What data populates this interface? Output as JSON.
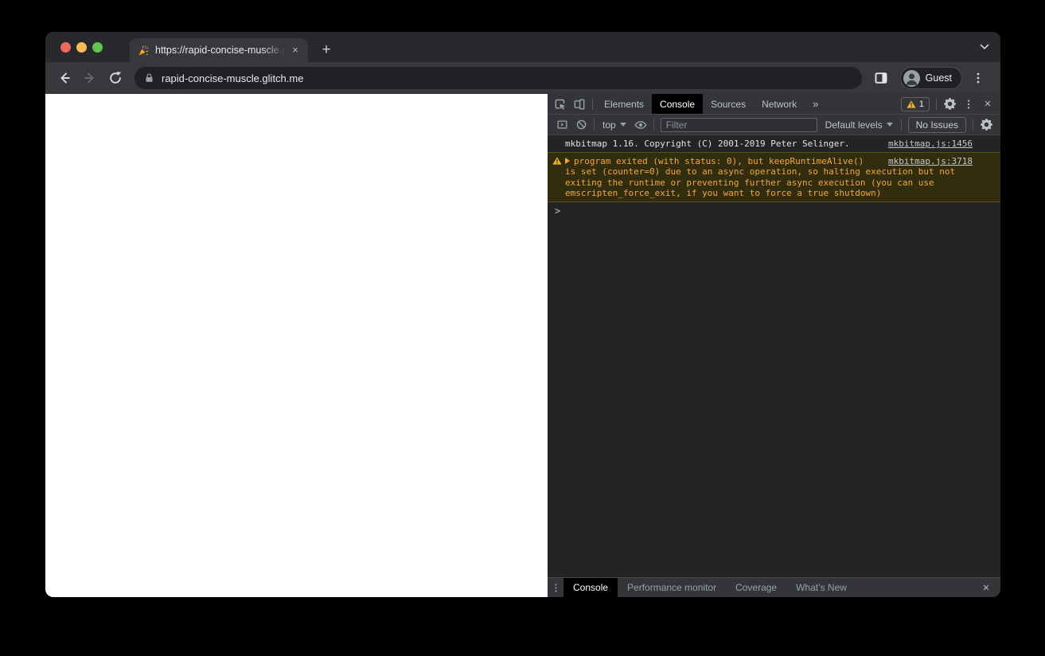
{
  "browser": {
    "tab": {
      "title": "https://rapid-concise-muscle.g",
      "close_glyph": "×"
    },
    "new_tab_glyph": "+",
    "address": {
      "url": "rapid-concise-muscle.glitch.me"
    },
    "profile": {
      "label": "Guest"
    }
  },
  "devtools": {
    "tabs": {
      "elements": "Elements",
      "console": "Console",
      "sources": "Sources",
      "network": "Network",
      "more": "»"
    },
    "warning_badge": {
      "count": "1"
    },
    "close_glyph": "×",
    "toolbar": {
      "context": "top",
      "filter_placeholder": "Filter",
      "levels_label": "Default levels",
      "issues_label": "No Issues"
    },
    "console": {
      "messages": [
        {
          "level": "log",
          "text": "mkbitmap 1.16. Copyright (C) 2001-2019 Peter Selinger.",
          "source": "mkbitmap.js:1456"
        },
        {
          "level": "warning",
          "text": "program exited (with status: 0), but keepRuntimeAlive() is set (counter=0) due to an async operation, so halting execution but not exiting the runtime or preventing further async execution (you can use emscripten_force_exit, if you want to force a true shutdown)",
          "source": "mkbitmap.js:3718"
        }
      ],
      "prompt_glyph": ">"
    },
    "drawer": {
      "tabs": [
        "Console",
        "Performance monitor",
        "Coverage",
        "What’s New"
      ],
      "active_tab": "Console",
      "close_glyph": "×"
    }
  },
  "colors": {
    "traffic_close": "#ee6a5f",
    "traffic_minimize": "#f5bd4f",
    "traffic_zoom": "#61c554",
    "warning_bg": "#332d10",
    "warning_text": "#f1a73c",
    "badge_yellow": "#f2b32a",
    "active_tab_bg": "#000000",
    "page_bg": "#ffffff"
  }
}
